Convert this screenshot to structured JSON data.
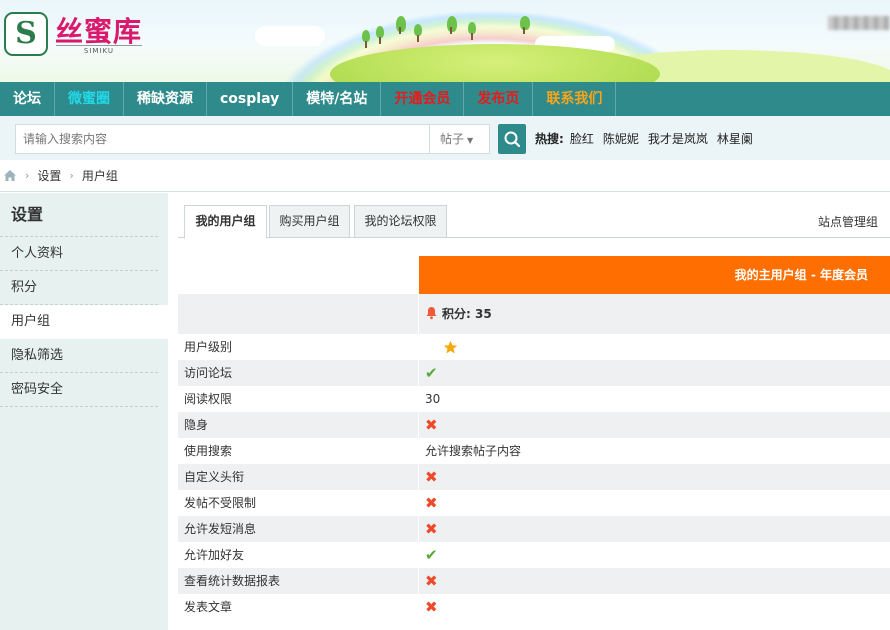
{
  "brand": {
    "name": "丝蜜库",
    "sub": "SIMIKU",
    "logo_letter": "S"
  },
  "nav": [
    {
      "label": "论坛",
      "color": "white"
    },
    {
      "label": "微蜜圈",
      "color": "cyan"
    },
    {
      "label": "稀缺资源",
      "color": "white"
    },
    {
      "label": "cosplay",
      "color": "white"
    },
    {
      "label": "模特/名站",
      "color": "white"
    },
    {
      "label": "开通会员",
      "color": "red"
    },
    {
      "label": "发布页",
      "color": "red"
    },
    {
      "label": "联系我们",
      "color": "orange"
    }
  ],
  "search": {
    "placeholder": "请输入搜索内容",
    "type_label": "帖子",
    "hot_label": "热搜:",
    "hot_terms": [
      "脸红",
      "陈妮妮",
      "我才是岚岚",
      "林星阑"
    ]
  },
  "breadcrumb": [
    "设置",
    "用户组"
  ],
  "sidebar": {
    "title": "设置",
    "items": [
      {
        "label": "个人资料"
      },
      {
        "label": "积分"
      },
      {
        "label": "用户组"
      },
      {
        "label": "隐私筛选"
      },
      {
        "label": "密码安全"
      }
    ]
  },
  "tabs": [
    {
      "label": "我的用户组"
    },
    {
      "label": "购买用户组"
    },
    {
      "label": "我的论坛权限"
    }
  ],
  "site_admin": "站点管理组",
  "group": {
    "header": "我的主用户组 - 年度会员",
    "score_label": "积分: 35"
  },
  "rows": [
    {
      "label": "用户级别",
      "kind": "level"
    },
    {
      "label": "访问论坛",
      "kind": "ok"
    },
    {
      "label": "阅读权限",
      "kind": "text",
      "value": "30"
    },
    {
      "label": "隐身",
      "kind": "no"
    },
    {
      "label": "使用搜索",
      "kind": "text",
      "value": "允许搜索帖子内容"
    },
    {
      "label": "自定义头衔",
      "kind": "no"
    },
    {
      "label": "发帖不受限制",
      "kind": "no"
    },
    {
      "label": "允许发短消息",
      "kind": "no"
    },
    {
      "label": "允许加好友",
      "kind": "ok"
    },
    {
      "label": "查看统计数据报表",
      "kind": "no"
    },
    {
      "label": "发表文章",
      "kind": "no"
    }
  ],
  "colors": {
    "nav_bg": "#2f8a8c",
    "header_orange": "#ff6e00",
    "check_green": "#5ba83a",
    "cross_red": "#ee4a2a"
  }
}
